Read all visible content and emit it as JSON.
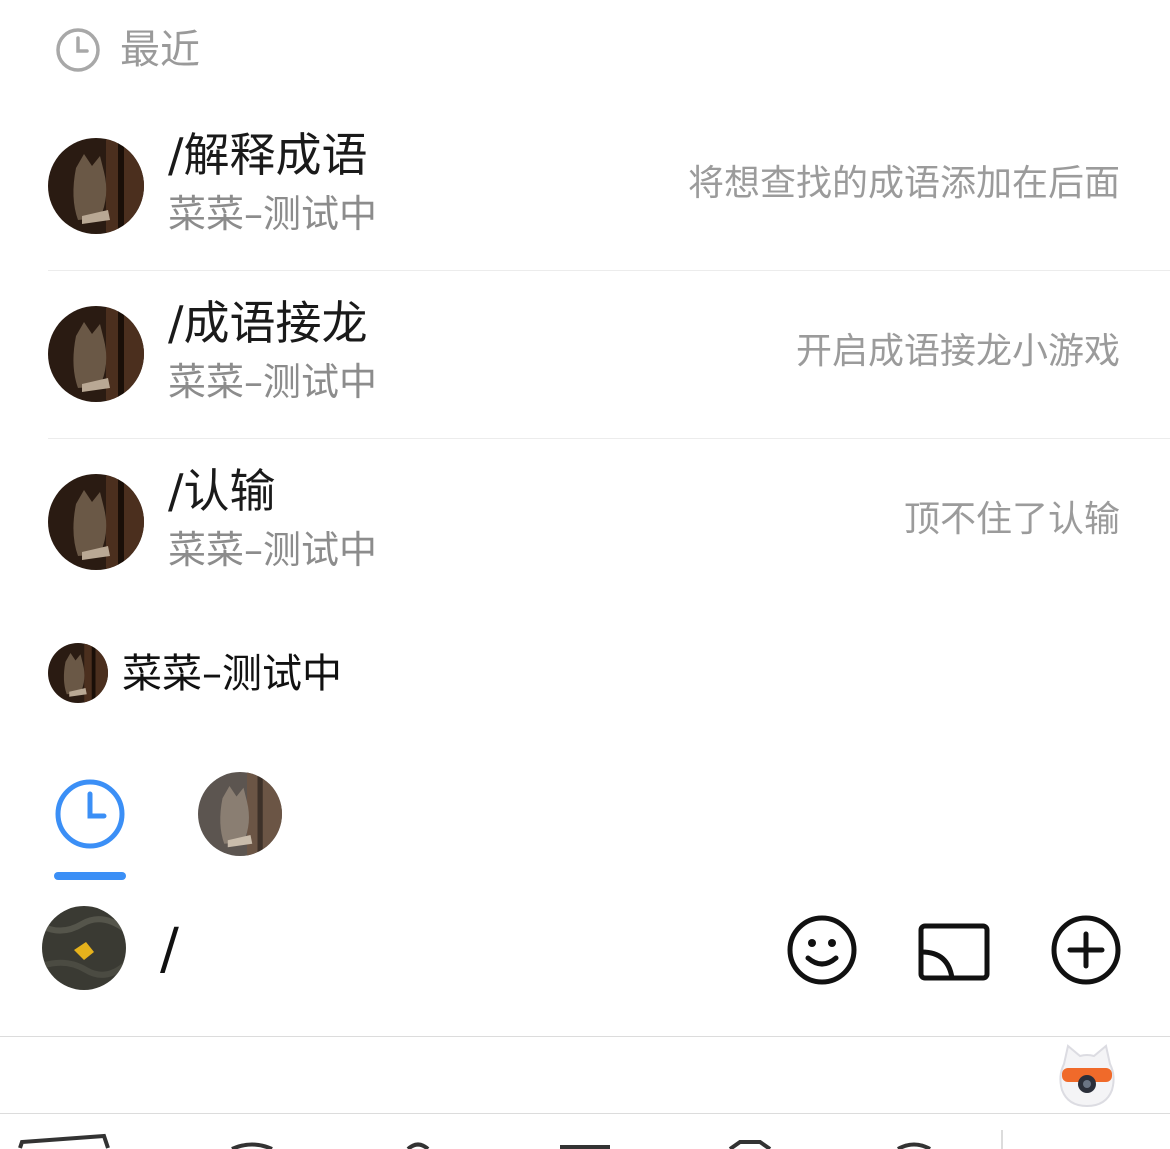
{
  "header": {
    "title": "最近",
    "icon": "clock-icon"
  },
  "commands": [
    {
      "command": "/解释成语",
      "bot": "菜菜–测试中",
      "description": "将想查找的成语添加在后面"
    },
    {
      "command": "/成语接龙",
      "bot": "菜菜–测试中",
      "description": "开启成语接龙小游戏"
    },
    {
      "command": "/认输",
      "bot": "菜菜–测试中",
      "description": "顶不住了认输"
    }
  ],
  "bot_section": {
    "name": "菜菜–测试中"
  },
  "tabs": [
    {
      "name": "recent",
      "icon": "clock-icon",
      "active": true
    },
    {
      "name": "bot",
      "icon": "cat-avatar",
      "active": false
    }
  ],
  "input": {
    "value": "/"
  },
  "toolbar": {
    "emoji": "smiley-icon",
    "cast": "cast-icon",
    "plus": "plus-circle-icon"
  },
  "colors": {
    "accent": "#3b8ff6",
    "muted_text": "#9b9b9b",
    "divider": "#ececec"
  }
}
